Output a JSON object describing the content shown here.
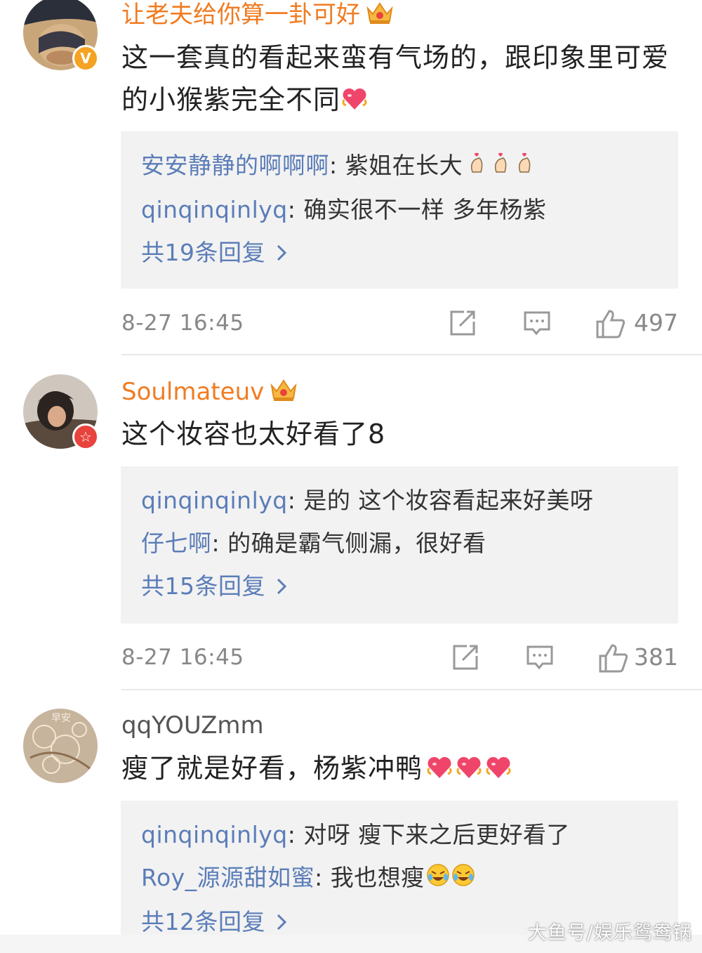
{
  "comments": [
    {
      "username": "让老夫给你算一卦可好",
      "content": "这一套真的看起来蛮有气场的，跟印象里可爱的小猴紫完全不同",
      "replies": [
        {
          "user": "安安静静的啊啊啊",
          "sep": ": ",
          "text": "紫姐在长大"
        },
        {
          "user": "qinqinqinlyq",
          "sep": ": ",
          "text": "确实很不一样 多年杨紫"
        }
      ],
      "more": "共19条回复",
      "time": "8-27 16:45",
      "likes": "497"
    },
    {
      "username": "Soulmateuv",
      "content": "这个妆容也太好看了8",
      "replies": [
        {
          "user": "qinqinqinlyq",
          "sep": ": ",
          "text": "是的 这个妆容看起来好美呀"
        },
        {
          "user": "仔七啊",
          "sep": ": ",
          "text": "的确是霸气侧漏，很好看"
        }
      ],
      "more": "共15条回复",
      "time": "8-27 16:45",
      "likes": "381"
    },
    {
      "username": "qqYOUZmm",
      "content": "瘦了就是好看，杨紫冲鸭",
      "replies": [
        {
          "user": "qinqinqinlyq",
          "sep": ": ",
          "text": "对呀 瘦下来之后更好看了"
        },
        {
          "user": "Roy_源源甜如蜜",
          "sep": ": ",
          "text": "我也想瘦"
        }
      ],
      "more": "共12条回复"
    }
  ],
  "watermark": "大鱼号/娱乐鸳鸯锅",
  "colors": {
    "username_highlight": "#f07c22",
    "reply_user": "#5b7db8",
    "reply_bg": "#f2f2f2",
    "meta_text": "#888888",
    "verified_badge": "#f4a422",
    "star_badge": "#e8433d"
  },
  "icons": [
    "crown-icon",
    "verified-badge-icon",
    "heart-emoji-icon",
    "finger-heart-emoji-icon",
    "laugh-cry-emoji-icon",
    "share-icon",
    "comment-icon",
    "thumbs-up-icon",
    "chevron-right-icon"
  ]
}
